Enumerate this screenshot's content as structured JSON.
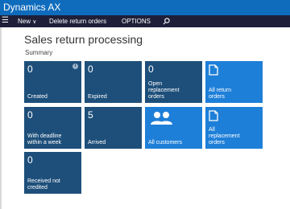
{
  "app": {
    "title": "Dynamics AX"
  },
  "actionbar": {
    "new_label": "New",
    "delete_label": "Delete return orders",
    "options_label": "OPTIONS"
  },
  "page": {
    "title": "Sales return processing",
    "section": "Summary"
  },
  "tiles": [
    {
      "count": "0",
      "label": "Created",
      "style": "dark",
      "has_info": true
    },
    {
      "count": "0",
      "label": "Expired",
      "style": "dark"
    },
    {
      "count": "0",
      "label": "Open\nreplacement\norders",
      "style": "dark"
    },
    {
      "icon": "document-icon",
      "label": "All return\norders",
      "style": "bright"
    },
    {
      "count": "0",
      "label": "With deadline\nwithin a week",
      "style": "dark"
    },
    {
      "count": "5",
      "label": "Arrived",
      "style": "dark"
    },
    {
      "icon": "people-icon",
      "label": "All customers",
      "style": "bright"
    },
    {
      "icon": "document-icon",
      "label": "All\nreplacement\norders",
      "style": "bright"
    },
    {
      "count": "0",
      "label": "Received not\ncredited",
      "style": "dark"
    }
  ],
  "colors": {
    "titlebar": "#0f6cbd",
    "actionbar": "#1f1f3a",
    "tile_dark": "#1e4f7a",
    "tile_bright": "#1e7fd8"
  }
}
